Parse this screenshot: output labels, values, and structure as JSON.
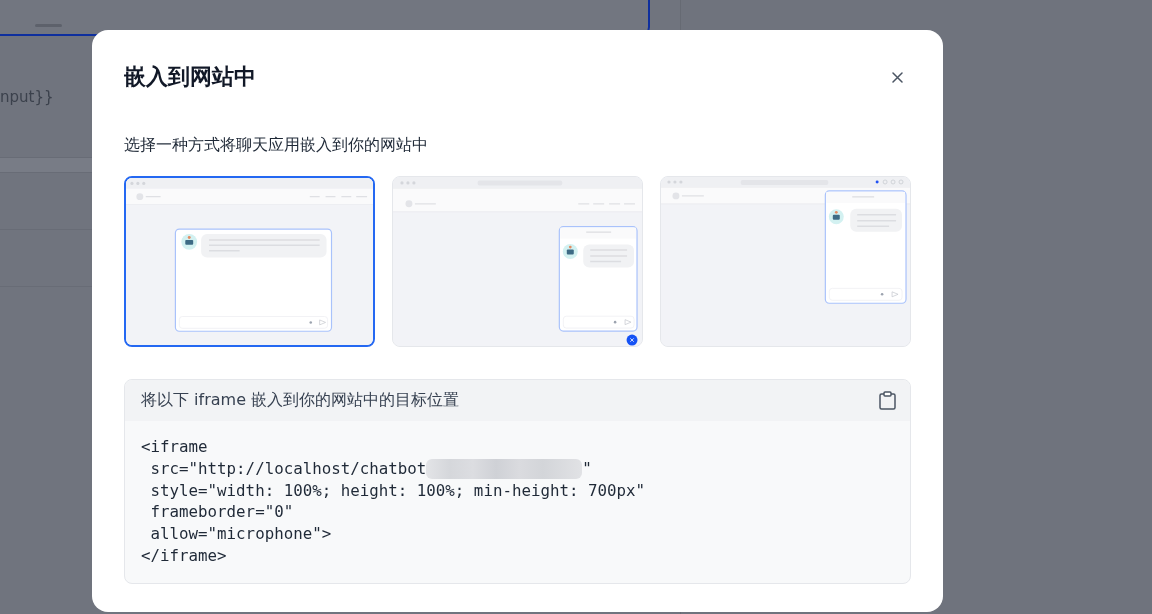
{
  "background_page": {
    "fragment_text": "nput}}"
  },
  "dialog": {
    "title": "嵌入到网站中",
    "subtitle": "选择一种方式将聊天应用嵌入到你的网站中",
    "options": [
      {
        "kind": "page",
        "selected": true
      },
      {
        "kind": "bubble",
        "selected": false
      },
      {
        "kind": "extension",
        "selected": false
      }
    ],
    "code_panel": {
      "heading": "将以下 iframe 嵌入到你的网站中的目标位置",
      "lines": [
        {
          "text": "<iframe"
        },
        {
          "text": " src=\"http://localhost/chatbot",
          "redacted": true,
          "tail": "\""
        },
        {
          "text": " style=\"width: 100%; height: 100%; min-height: 700px\""
        },
        {
          "text": " frameborder=\"0\""
        },
        {
          "text": " allow=\"microphone\">"
        },
        {
          "text": "</iframe>"
        }
      ]
    }
  }
}
